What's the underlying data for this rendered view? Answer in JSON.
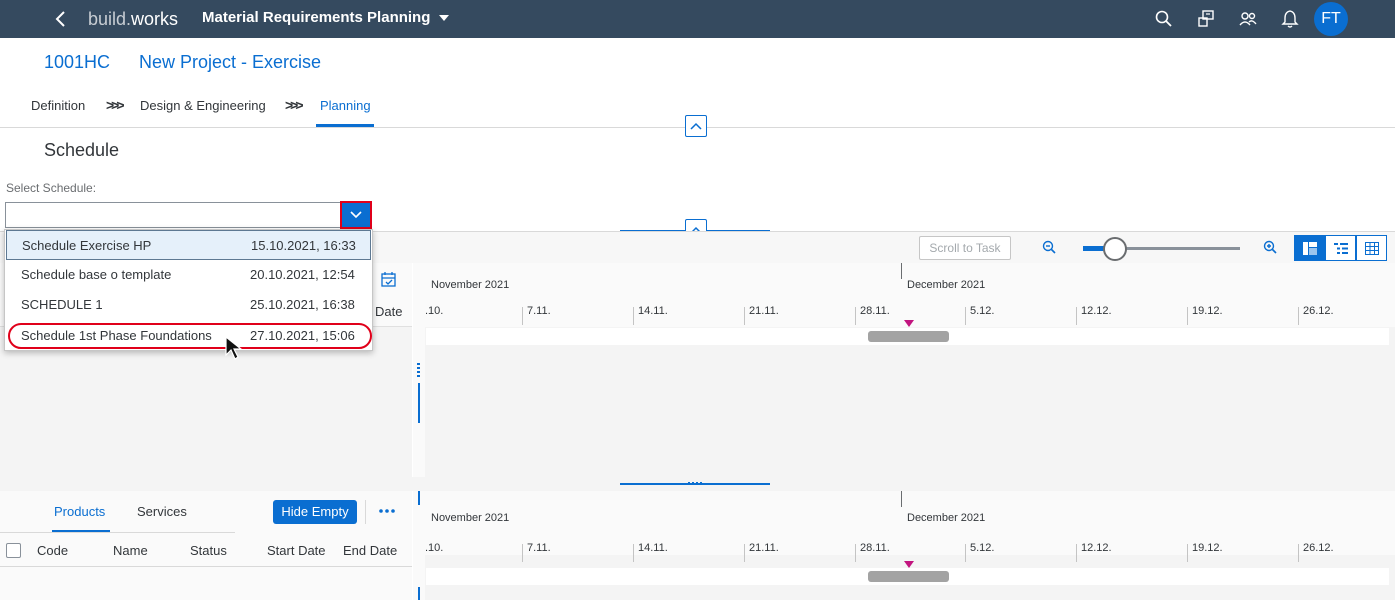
{
  "shell": {
    "brand_prefix": "build.",
    "brand_suffix": "works",
    "app_title": "Material Requirements Planning",
    "avatar_initials": "FT"
  },
  "object": {
    "id": "1001HC",
    "name": "New Project - Exercise"
  },
  "breadcrumb": {
    "items": [
      "Definition",
      "Design & Engineering",
      "Planning"
    ],
    "active": "Planning"
  },
  "schedule": {
    "title": "Schedule",
    "select_label": "Select Schedule:",
    "select_value": "",
    "options": [
      {
        "name": "Schedule Exercise HP",
        "date": "15.10.2021, 16:33"
      },
      {
        "name": "Schedule base o template",
        "date": "20.10.2021, 12:54"
      },
      {
        "name": "SCHEDULE 1",
        "date": "25.10.2021, 16:38"
      },
      {
        "name": "Schedule 1st Phase Foundations",
        "date": "27.10.2021, 15:06"
      }
    ]
  },
  "toolbar": {
    "scroll_to_task": "Scroll to Task",
    "zoom_level": 0.2
  },
  "upper_table": {
    "end_date_header": "Date"
  },
  "timeline": {
    "months": [
      "November 2021",
      "December 2021"
    ],
    "weeks": [
      ".10.",
      "7.11.",
      "14.11.",
      "21.11.",
      "28.11.",
      "5.12.",
      "12.12.",
      "19.12.",
      "26.12."
    ]
  },
  "bottom": {
    "tabs": [
      "Products",
      "Services"
    ],
    "hide_empty": "Hide Empty",
    "columns": [
      "Code",
      "Name",
      "Status",
      "Start Date",
      "End Date"
    ]
  },
  "colors": {
    "shell_bg": "#354a5f",
    "accent": "#0a6ed1",
    "highlight": "#e0001a",
    "today_marker": "#c2157f"
  }
}
